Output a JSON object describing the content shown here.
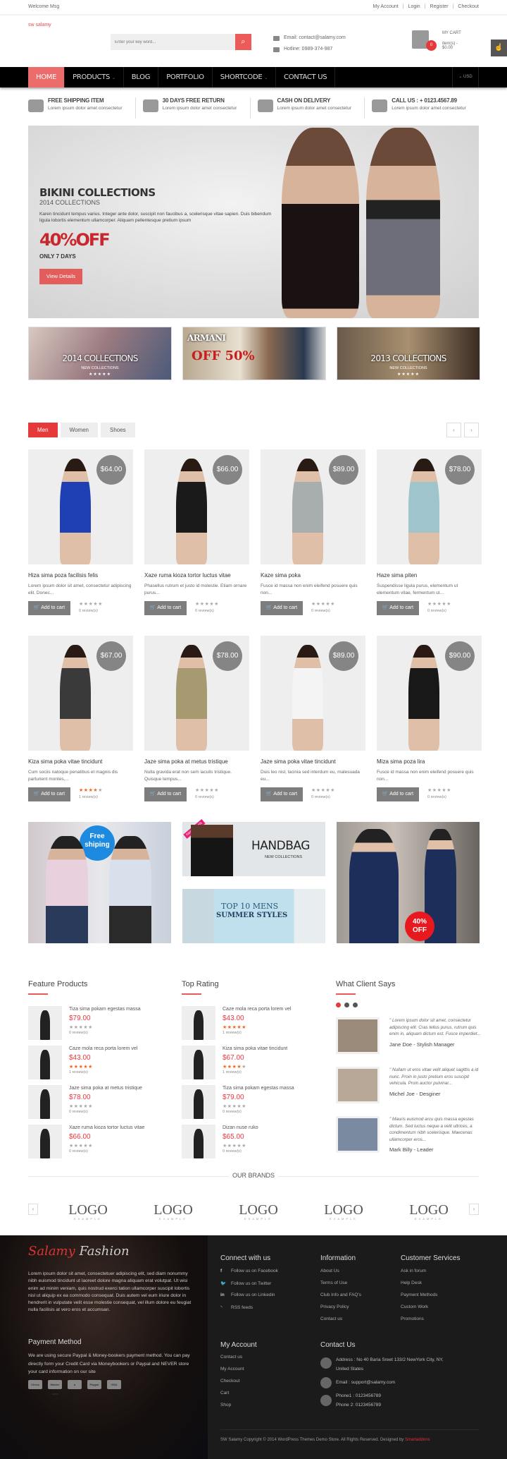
{
  "colors": {
    "accent": "#ec5a5a",
    "nav_bg": "#000000",
    "price_badge": "#858585",
    "star_on": "#f26522",
    "footer_bg": "#1b1b1b"
  },
  "topbar": {
    "welcome": "Welcome Msg",
    "links": [
      "My Account",
      "Login",
      "Register",
      "Checkout"
    ]
  },
  "header": {
    "logo": "sw salamy",
    "search_placeholder": "Enter your key word...",
    "email": "Email: contact@salamy.com",
    "hotline": "Hotline: 0989-374-987",
    "cart_title": "MY CART",
    "cart_count": "0",
    "cart_summary": "item(s) - $0.00"
  },
  "nav": {
    "items": [
      "Home",
      "Products",
      "Blog",
      "Portfolio",
      "Shortcode",
      "Contact Us"
    ],
    "currency": "USD"
  },
  "features": [
    {
      "icon": "truck-icon",
      "title": "FREE SHIPPING ITEM",
      "desc": "Lorem ipsum dolor amet consectetur"
    },
    {
      "icon": "calendar-icon",
      "title": "30 DAYS FREE RETURN",
      "desc": "Lorem ipsum dolor amet consectetur"
    },
    {
      "icon": "coins-icon",
      "title": "CASH ON DELIVERY",
      "desc": "Lorem ipsum dolor amet consectetur"
    },
    {
      "icon": "phone-icon",
      "title": "CALL US : + 0123.4567.89",
      "desc": "Lorem ipsum dolor amet consectetur"
    }
  ],
  "hero": {
    "title": "BIKINI COLLECTIONS",
    "subtitle": "2014 COLLECTIONS",
    "desc": "Karen tincidunt tempus varius. Integer ante dolor, suscipit non faucibus a, scelerisque vitae sapien. Duis bibendum ligula lobortis elementum ullamcorper. Aliquam pellentesque pretium ipsum",
    "offer": "40%OFF",
    "days": "ONLY 7 DAYS",
    "button": "View Details"
  },
  "banners": [
    {
      "title": "2014 COLLECTIONS",
      "sub": "NEW COLLECTIONS",
      "stars": "★★★★★"
    },
    {
      "title": "ARMANI",
      "sub": "OFF 50%",
      "stars": ""
    },
    {
      "title": "2013 COLLECTIONS",
      "sub": "NEW COLLECTIONS",
      "stars": "★★★★★"
    }
  ],
  "tabs": {
    "items": [
      "Men",
      "Women",
      "Shoes"
    ],
    "active": "Men",
    "prev": "‹",
    "next": "›"
  },
  "products": [
    {
      "name": "Hiza sima poza facilisis felis",
      "price": "$64.00",
      "desc": "Lorem ipsum dolor sit amet, consectetur adipiscing elit. Donec...",
      "rating": 0,
      "reviews": "0 review(s)",
      "color": "#1f3fb5"
    },
    {
      "name": "Xaze ruma kioza tortor luctus vitae",
      "price": "$66.00",
      "desc": "Phasellus rutrum et justo id molestie. Etiam ornare purus...",
      "rating": 0,
      "reviews": "0 review(s)",
      "color": "#1a1a1a"
    },
    {
      "name": "Kaze sima poka",
      "price": "$89.00",
      "desc": "Fusce id massa non enim eleifend posuere quis non...",
      "rating": 0,
      "reviews": "0 review(s)",
      "color": "#a8aeae"
    },
    {
      "name": "Haze sima piten",
      "price": "$78.00",
      "desc": "Suspendisse ligula purus, elementum ut elementum vitae, fermentum ut...",
      "rating": 0,
      "reviews": "0 review(s)",
      "color": "#9fc4cc"
    },
    {
      "name": "Kiza sima poka vitae tincidunt",
      "price": "$67.00",
      "desc": "Cum sociis natoque penatibus et magnis dis parturient montes,...",
      "rating": 4,
      "reviews": "1 review(s)",
      "color": "#3a3a3a"
    },
    {
      "name": "Jaze sima poka at metus tristique",
      "price": "$78.00",
      "desc": "Nulla gravida erat non sem iaculis tristique. Quisque tempus...",
      "rating": 0,
      "reviews": "0 review(s)",
      "color": "#a89a70"
    },
    {
      "name": "Jaze sima poka vitae tincidunt",
      "price": "$89.00",
      "desc": "Duis leo nisl, lacinia sed interdum eu, malesuada eu...",
      "rating": 0,
      "reviews": "0 review(s)",
      "color": "#f4f4f4"
    },
    {
      "name": "Miza sima poza lira",
      "price": "$90.00",
      "desc": "Fusce id massa non enim eleifend posuere quis non...",
      "rating": 0,
      "reviews": "0 review(s)",
      "color": "#181818"
    }
  ],
  "add_to_cart": "Add to cart",
  "promos": {
    "free": "Free shiping",
    "handbag": "HANDBAG",
    "handbag_sub": "NEW COLLECTIONS",
    "new_arrivals": "New Arrivals",
    "top10": "TOP 10 MENS",
    "summer": "SUMMER STYLES",
    "off": "40% OFF"
  },
  "feature_products": {
    "title": "Feature Products",
    "items": [
      {
        "name": "Tiza sima pokam egestas massa",
        "price": "$79.00",
        "rating": 0,
        "reviews": "0 review(s)"
      },
      {
        "name": "Caze mola reca porta lorem vel",
        "price": "$43.00",
        "rating": 5,
        "reviews": "1 review(s)"
      },
      {
        "name": "Jaze sima poka at metus tristique",
        "price": "$78.00",
        "rating": 0,
        "reviews": "0 review(s)"
      },
      {
        "name": "Xaze ruma kioza tortor luctus vitae",
        "price": "$66.00",
        "rating": 0,
        "reviews": "0 review(s)"
      }
    ]
  },
  "top_rating": {
    "title": "Top Rating",
    "items": [
      {
        "name": "Caze mola reca porta lorem vel",
        "price": "$43.00",
        "rating": 5,
        "reviews": "1 review(s)"
      },
      {
        "name": "Kiza sima poka vitae tincidunt",
        "price": "$67.00",
        "rating": 4,
        "reviews": "1 review(s)"
      },
      {
        "name": "Tiza sima pokam egestas massa",
        "price": "$79.00",
        "rating": 0,
        "reviews": "0 review(s)"
      },
      {
        "name": "Dizan nuse ruko",
        "price": "$65.00",
        "rating": 0,
        "reviews": "0 review(s)"
      }
    ]
  },
  "testimonials": {
    "title": "What Client Says",
    "items": [
      {
        "quote": "\" Lorem ipsum dolor sit amet, consectetur adipiscing elit. Cras tellus purus, rutrum quis enim in, aliquam dictum est. Fusce imperdiet...",
        "who": "Jane Doe - Stylish Manager"
      },
      {
        "quote": "\" Nullam ut eros vitae velit aliquet sagittis a id nunc. Proin in justo pretium eros suscipit vehicula. Proin auctor pulvinar...",
        "who": "Michel Joe - Desginer"
      },
      {
        "quote": "\" Mauris euismod arcu quis massa egestas dictum. Sed luctus neque a velit ultrices, a condimentum nibh scelerisque. Maecenas ullamcorper eros...",
        "who": "Mark Billy - Leader"
      }
    ]
  },
  "brands": {
    "title": "OUR BRANDS",
    "logo": "LOGO",
    "logo_sub": "EXAMPLE",
    "count": 5
  },
  "footer": {
    "logo": "Salamy Fashion",
    "about": "Lorem ipsum dolor sit amet, consectetuer adipiscing elit, sed diam nonummy nibh euismod tincidunt ut laoreet dolore magna aliquam erat volutpat. Ut wisi enim ad minim veniam, quis nostrud exerci tation ullamcorper suscipit lobortis nisl ut aliquip ex ea commodo consequat. Duis autem vel eum iriure dolor in hendrerit in vulputate velit esse molestie consequat, vel illum dolore eu feugiat nulla facilisis at vero eros et accumsan.",
    "payment_title": "Payment Method",
    "payment_text": "We are using secure Paypal & Money-bookers payment method. You can pay directly form your Credit Card via Moneybookers or Paypal and NEVER store your card information on our site",
    "payment_icons": [
      "Cirrus",
      "Master Card",
      "a",
      "Paypal",
      "VISA"
    ],
    "connect_title": "Connect with us",
    "connect": [
      "Follow us on Facebook",
      "Follow us on Twitter",
      "Follow us on Linkedin",
      "RSS feeds"
    ],
    "info_title": "Information",
    "info": [
      "About Us",
      "Terms of Use",
      "Club Info and FAQ's",
      "Privacy Policy",
      "Contact us"
    ],
    "cs_title": "Customer Services",
    "cs": [
      "Ask in forum",
      "Help Desk",
      "Payment Methods",
      "Custom Work",
      "Promotions"
    ],
    "account_title": "My Account",
    "account": [
      "Contact us",
      "My Account",
      "Checkout",
      "Cart",
      "Shop"
    ],
    "contact_title": "Contact Us",
    "address": "Address : No 40 Baria Sreet 133/2 NewYork City, NY, United States",
    "email": "Email : support@salamy.com",
    "phone1": "Phone1 : 0123456789",
    "phone2": "Phone 2: 0123456789",
    "copyright": "SW Salamy Copyright © 2014 WordPress Themes Demo Store. All Rights Reserved. Designed by ",
    "designer": "Smartaddons"
  }
}
